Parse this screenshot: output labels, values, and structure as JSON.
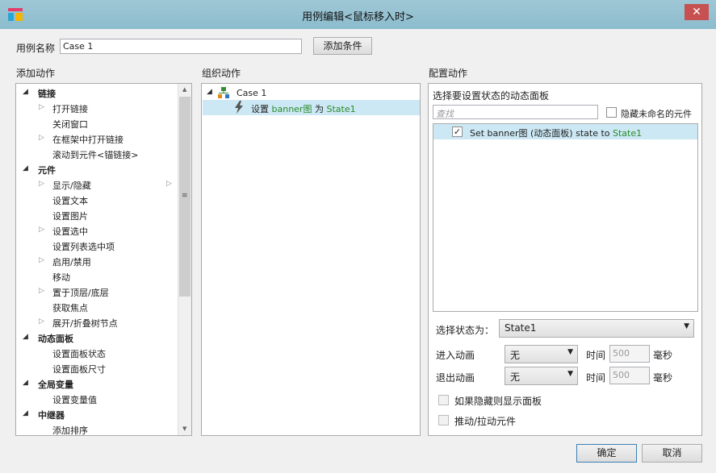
{
  "window": {
    "title": "用例编辑<鼠标移入时>",
    "close": "✕"
  },
  "case_name": {
    "label": "用例名称",
    "value": "Case 1"
  },
  "add_condition": "添加条件",
  "headers": {
    "add_action": "添加动作",
    "organize": "组织动作",
    "configure": "配置动作"
  },
  "actions": {
    "link": {
      "label": "链接",
      "items": [
        "打开链接",
        "关闭窗口",
        "在框架中打开链接",
        "滚动到元件<锚链接>"
      ]
    },
    "widget": {
      "label": "元件",
      "items": [
        "显示/隐藏",
        "设置文本",
        "设置图片",
        "设置选中",
        "设置列表选中项",
        "启用/禁用",
        "移动",
        "置于顶层/底层",
        "获取焦点",
        "展开/折叠树节点"
      ]
    },
    "panel": {
      "label": "动态面板",
      "items": [
        "设置面板状态",
        "设置面板尺寸"
      ]
    },
    "global": {
      "label": "全局变量",
      "items": [
        "设置变量值"
      ]
    },
    "repeater": {
      "label": "中继器",
      "items": [
        "添加排序"
      ]
    }
  },
  "organize": {
    "case": "Case 1",
    "action": {
      "prefix": "设置",
      "target": "banner图",
      "mid": "为",
      "state": "State1"
    }
  },
  "configure": {
    "panel_title": "选择要设置状态的动态面板",
    "search_placeholder": "查找",
    "hide_unnamed": "隐藏未命名的元件",
    "item": {
      "prefix": "Set banner图 (动态面板) state to",
      "state": "State1"
    },
    "select_state_label": "选择状态为：",
    "select_state_value": "State1",
    "enter_anim_label": "进入动画",
    "enter_anim_value": "无",
    "exit_anim_label": "退出动画",
    "exit_anim_value": "无",
    "time_label": "时间",
    "time_value": "500",
    "ms": "毫秒",
    "show_if_hidden": "如果隐藏则显示面板",
    "push_pull": "推动/拉动元件"
  },
  "buttons": {
    "ok": "确定",
    "cancel": "取消"
  },
  "colors": {
    "accent": "#2a8a2a",
    "selection": "#cce8f4"
  }
}
